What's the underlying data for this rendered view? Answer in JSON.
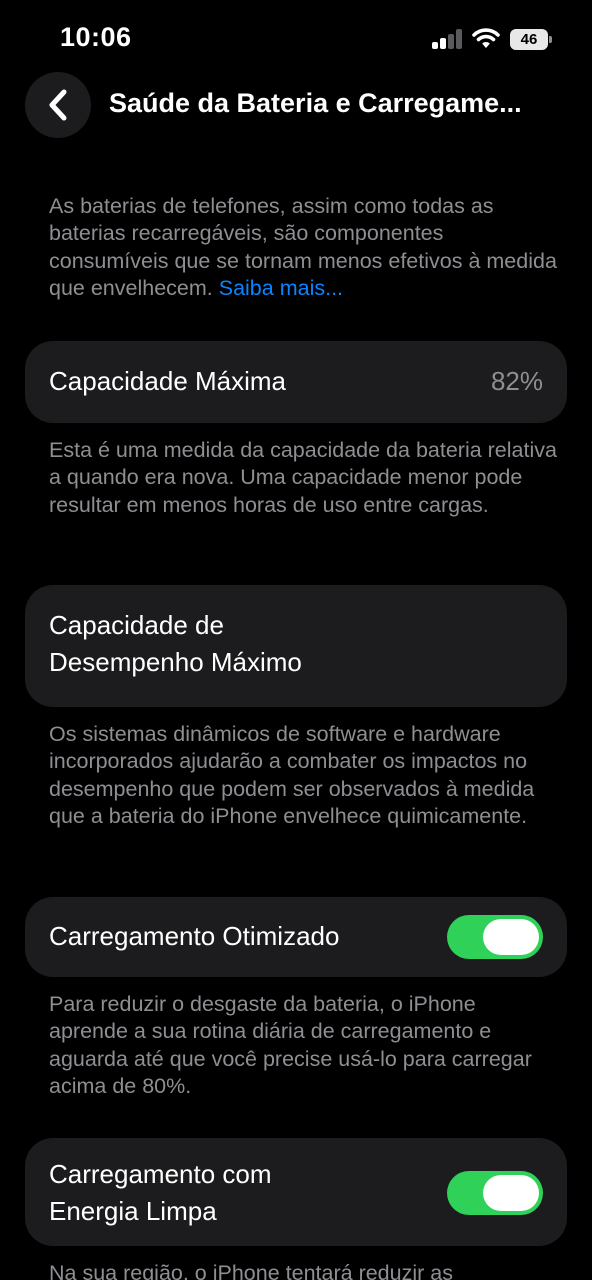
{
  "status_bar": {
    "time": "10:06",
    "battery_level": "46"
  },
  "nav": {
    "back_icon": "chevron-left-icon",
    "title": "Saúde da Bateria e Carregame..."
  },
  "intro": {
    "text": "As baterias de telefones, assim como todas as baterias recarregáveis, são componentes consumíveis que se tornam menos efetivos à medida que envelhecem.",
    "link": "Saiba mais..."
  },
  "max_capacity": {
    "label": "Capacidade Máxima",
    "value": "82%",
    "description": "Esta é uma medida da capacidade da bateria relativa a quando era nova. Uma capacidade menor pode resultar em menos horas de uso entre cargas."
  },
  "peak_performance": {
    "label_line1": "Capacidade de",
    "label_line2": "Desempenho Máximo",
    "description": "Os sistemas dinâmicos de software e hardware incorporados ajudarão a combater os impactos no desempenho que podem ser observados à medida que a bateria do iPhone envelhece quimicamente."
  },
  "optimized_charging": {
    "label": "Carregamento Otimizado",
    "enabled": true,
    "description": "Para reduzir o desgaste da bateria, o iPhone aprende a sua rotina diária de carregamento e aguarda até que você precise usá-lo para carregar acima de 80%."
  },
  "clean_energy": {
    "label_line1": "Carregamento com",
    "label_line2": "Energia Limpa",
    "enabled": true,
    "description": "Na sua região, o iPhone tentará reduzir as"
  },
  "colors": {
    "background": "#000000",
    "card": "#1c1c1e",
    "secondary_text": "#8e8e93",
    "link": "#0a84ff",
    "toggle_on": "#30d158"
  }
}
